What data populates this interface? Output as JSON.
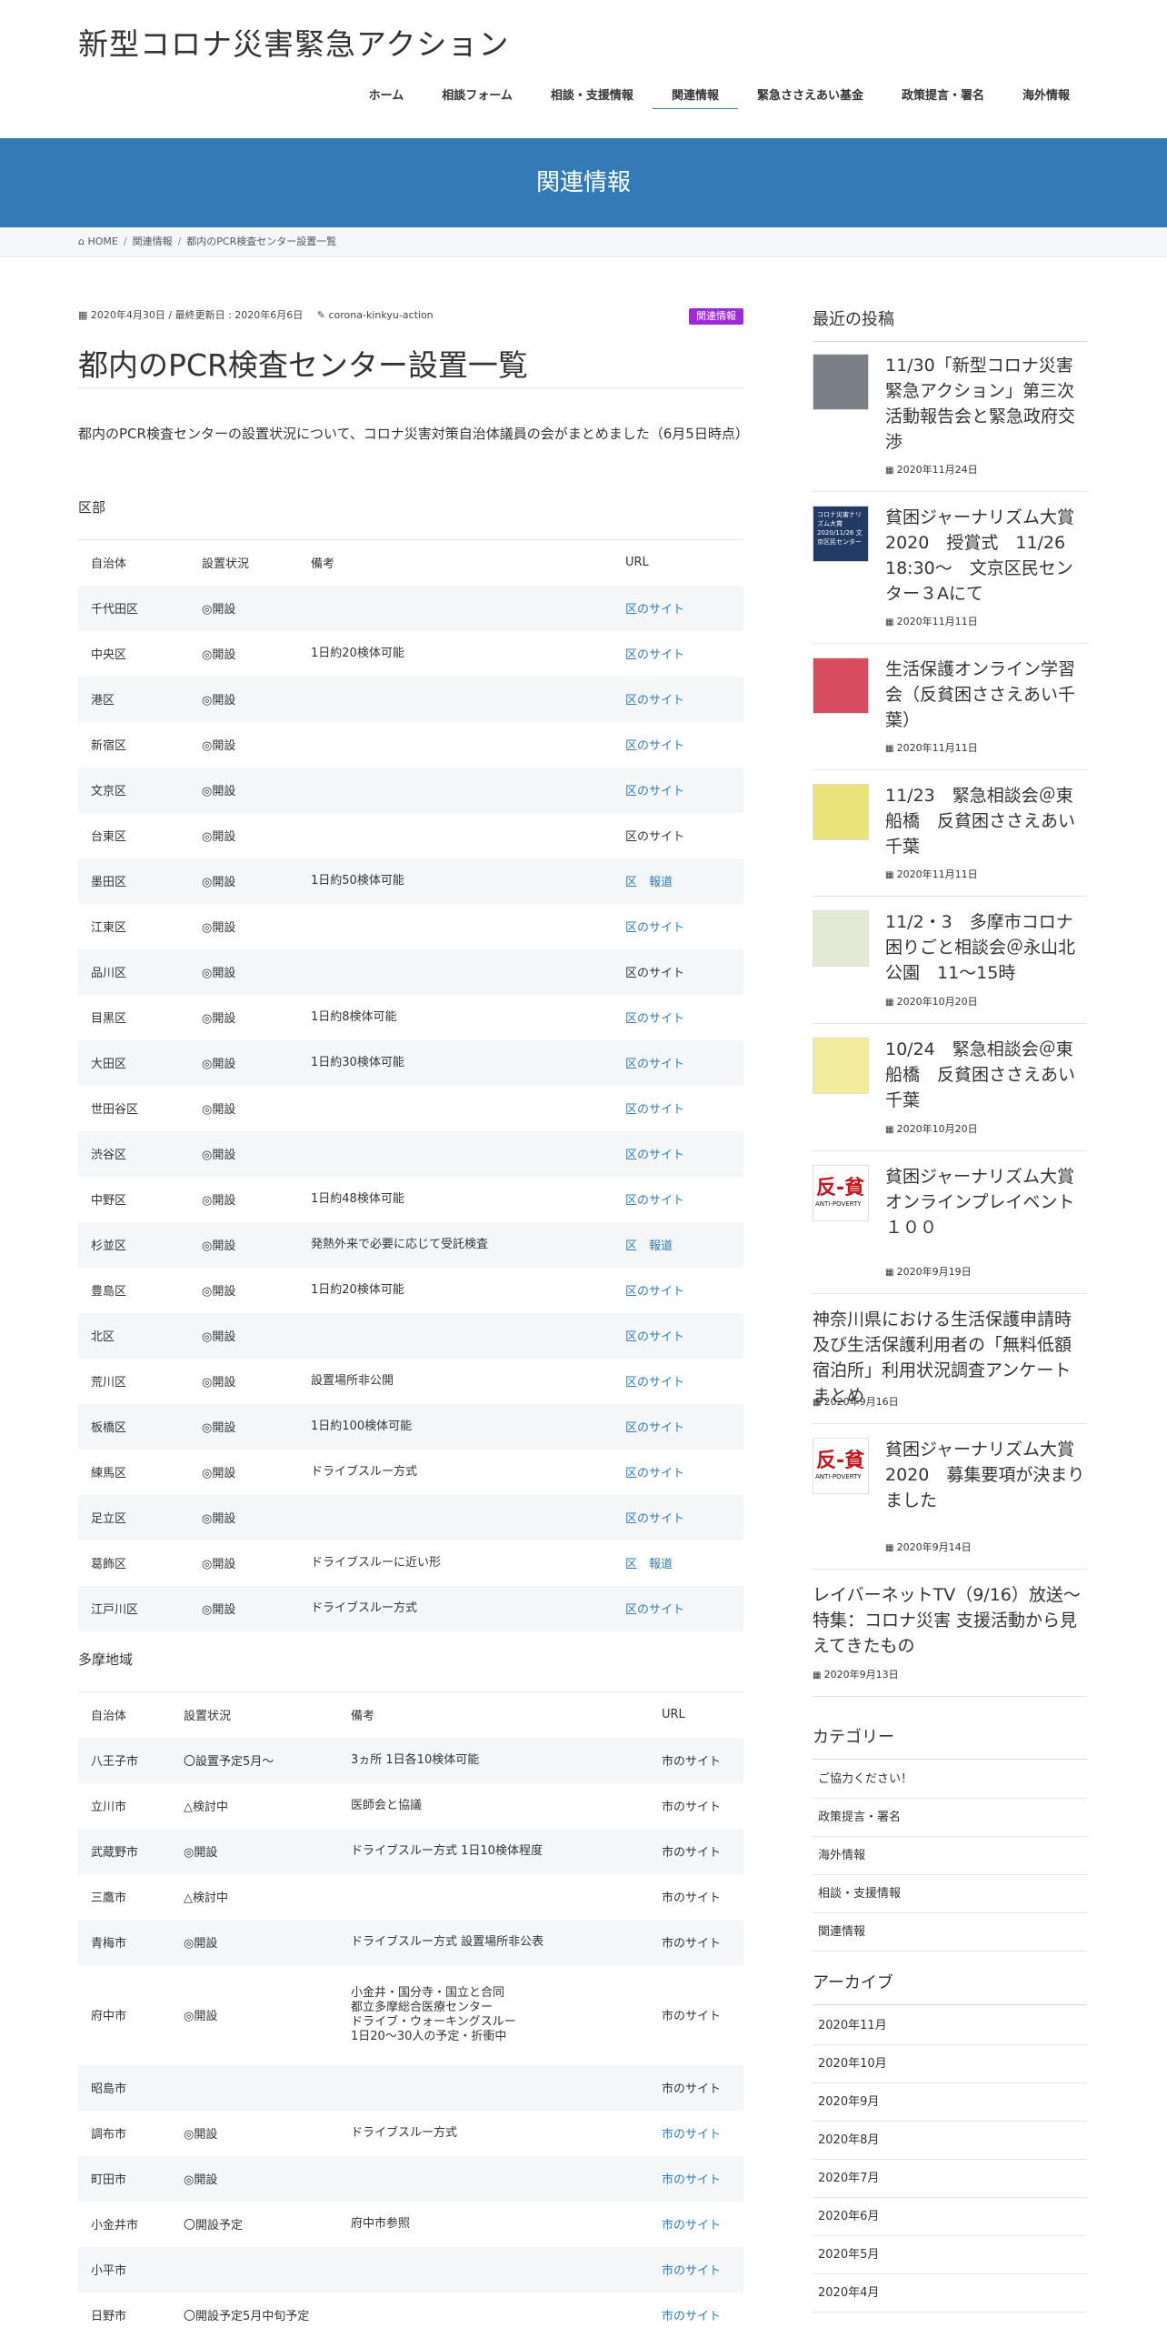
{
  "header": {
    "site_title": "新型コロナ災害緊急アクション",
    "nav": [
      "ホーム",
      "相談フォーム",
      "相談・支援情報",
      "関連情報",
      "緊急ささえあい基金",
      "政策提言・署名",
      "海外情報"
    ],
    "active_nav": "関連情報"
  },
  "page_header": {
    "title": "関連情報"
  },
  "breadcrumb": {
    "home": "HOME",
    "parent": "関連情報",
    "current": "都内のPCR検査センター設置一覧"
  },
  "article": {
    "meta": "2020年4月30日 / 最終更新日 : 2020年6月6日",
    "author": "corona-kinkyu-action",
    "category": "関連情報",
    "title": "都内のPCR検査センター設置一覧",
    "lead": "都内のPCR検査センターの設置状況について、コロナ災害対策自治体議員の会がまとめました（6月5日時点）",
    "ku_label": "区部",
    "tama_label": "多摩地域",
    "ku_headers": [
      "自治体",
      "設置状況",
      "備考",
      "URL"
    ],
    "ku_rows": [
      [
        "千代田区",
        "◎開設",
        "",
        "区のサイト"
      ],
      [
        "中央区",
        "◎開設",
        "1日約20検体可能",
        "区のサイト"
      ],
      [
        "港区",
        "◎開設",
        "",
        "区のサイト"
      ],
      [
        "新宿区",
        "◎開設",
        "",
        "区のサイト"
      ],
      [
        "文京区",
        "◎開設",
        "",
        "区のサイト"
      ],
      [
        "台東区",
        "◎開設",
        "",
        "区のサイト"
      ],
      [
        "墨田区",
        "◎開設",
        "1日約50検体可能",
        "区　報道"
      ],
      [
        "江東区",
        "◎開設",
        "",
        "区のサイト"
      ],
      [
        "品川区",
        "◎開設",
        "",
        "区のサイト"
      ],
      [
        "目黒区",
        "◎開設",
        "1日約8検体可能",
        "区のサイト"
      ],
      [
        "大田区",
        "◎開設",
        "1日約30検体可能",
        "区のサイト"
      ],
      [
        "世田谷区",
        "◎開設",
        "",
        "区のサイト"
      ],
      [
        "渋谷区",
        "◎開設",
        "",
        "区のサイト"
      ],
      [
        "中野区",
        "◎開設",
        "1日約48検体可能",
        "区のサイト"
      ],
      [
        "杉並区",
        "◎開設",
        "発熱外来で必要に応じて受託検査",
        "区　報道"
      ],
      [
        "豊島区",
        "◎開設",
        "1日約20検体可能",
        "区のサイト"
      ],
      [
        "北区",
        "◎開設",
        "",
        "区のサイト"
      ],
      [
        "荒川区",
        "◎開設",
        "設置場所非公開",
        "区のサイト"
      ],
      [
        "板橋区",
        "◎開設",
        "1日約100検体可能",
        "区のサイト"
      ],
      [
        "練馬区",
        "◎開設",
        "ドライブスルー方式",
        "区のサイト"
      ],
      [
        "足立区",
        "◎開設",
        "",
        "区のサイト"
      ],
      [
        "葛飾区",
        "◎開設",
        "ドライブスルーに近い形",
        "区　報道"
      ],
      [
        "江戸川区",
        "◎開設",
        "ドライブスルー方式",
        "区のサイト"
      ]
    ],
    "tama_headers": [
      "自治体",
      "設置状況",
      "備考",
      "URL"
    ],
    "tama_rows": [
      [
        "八王子市",
        "〇設置予定5月～",
        "3ヵ所 1日各10検体可能",
        "市のサイト"
      ],
      [
        "立川市",
        "△検討中",
        "医師会と協議",
        "市のサイト"
      ],
      [
        "武蔵野市",
        "◎開設",
        "ドライブスルー方式 1日10検体程度",
        "市のサイト"
      ],
      [
        "三鷹市",
        "△検討中",
        "",
        "市のサイト"
      ],
      [
        "青梅市",
        "◎開設",
        "ドライブスルー方式 設置場所非公表",
        "市のサイト"
      ],
      [
        "府中市",
        "◎開設",
        "小金井・国分寺・国立と合同\n都立多摩総合医療センター\nドライブ・ウォーキングスルー\n1日20～30人の予定・折衝中",
        "市のサイト"
      ],
      [
        "昭島市",
        "",
        "",
        "市のサイト"
      ],
      [
        "調布市",
        "◎開設",
        "ドライブスルー方式",
        "市のサイト"
      ],
      [
        "町田市",
        "◎開設",
        "",
        "市のサイト"
      ],
      [
        "小金井市",
        "〇開設予定",
        "府中市参照",
        "市のサイト"
      ],
      [
        "小平市",
        "",
        "",
        "市のサイト"
      ],
      [
        "日野市",
        "〇開設予定5月中旬予定",
        "",
        "市のサイト"
      ]
    ]
  },
  "sidebar": {
    "recent_title": "最近の投稿",
    "posts": [
      {
        "title": "11/30「新型コロナ災害緊急アクション」第三次活動報告会と緊急政府交渉",
        "date": "2020年11月24日"
      },
      {
        "title": "貧困ジャーナリズム大賞2020　授賞式　11/26　18:30～　文京区民センター３Aにて",
        "date": "2020年11月11日"
      },
      {
        "title": "生活保護オンライン学習会（反貧困ささえあい千葉）",
        "date": "2020年11月11日"
      },
      {
        "title": "11/23　緊急相談会＠東船橋　反貧困ささえあい千葉",
        "date": "2020年11月11日"
      },
      {
        "title": "11/2・3　多摩市コロナ困りごと相談会＠永山北公園　11～15時",
        "date": "2020年10月20日"
      },
      {
        "title": "10/24　緊急相談会＠東船橋　反貧困ささえあい千葉",
        "date": "2020年10月20日"
      },
      {
        "title": "貧困ジャーナリズム大賞オンラインプレイベント１００",
        "date": "2020年9月19日"
      },
      {
        "title": "神奈川県における生活保護申請時及び生活保護利用者の「無料低額宿泊所」利用状況調査アンケートまとめ",
        "date": "2020年9月16日"
      },
      {
        "title": "貧困ジャーナリズム大賞2020　募集要項が決まりました",
        "date": "2020年9月14日"
      },
      {
        "title": "レイバーネットTV（9/16）放送〜特集：コロナ災害 支援活動から見えてきたもの",
        "date": "2020年9月13日"
      }
    ],
    "thumb_text": {
      "anti": "反-貧",
      "anti_sub": "ANTI-POVERTY",
      "banner": "コロナ災害ナリズム大賞2020/11/26 文京区民センター"
    },
    "category_title": "カテゴリー",
    "categories": [
      "ご協力ください！",
      "政策提言・署名",
      "海外情報",
      "相談・支援情報",
      "関連情報"
    ],
    "archive_title": "アーカイブ",
    "archives": [
      "2020年11月",
      "2020年10月",
      "2020年9月",
      "2020年8月",
      "2020年7月",
      "2020年6月",
      "2020年5月",
      "2020年4月"
    ]
  }
}
